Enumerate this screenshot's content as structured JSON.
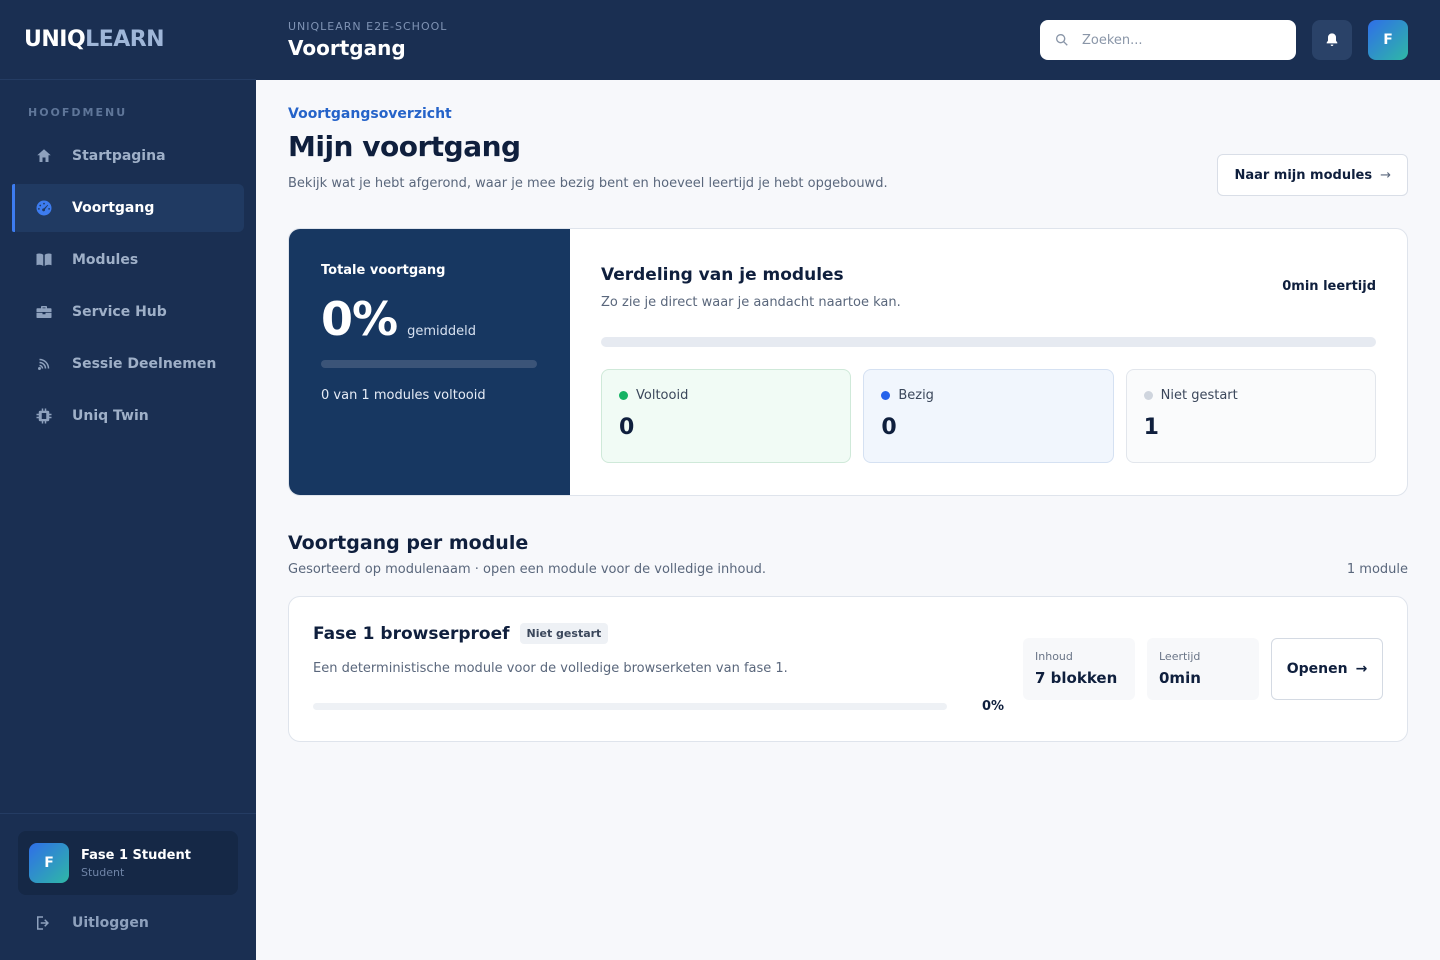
{
  "brand": {
    "logo_a": "UNIQ",
    "logo_b": "LEARN"
  },
  "sidebar": {
    "menu_label": "HOOFDMENU",
    "items": [
      {
        "label": "Startpagina",
        "icon": "home-icon"
      },
      {
        "label": "Voortgang",
        "icon": "gauge-icon",
        "active": true
      },
      {
        "label": "Modules",
        "icon": "book-icon"
      },
      {
        "label": "Service Hub",
        "icon": "toolbox-icon"
      },
      {
        "label": "Sessie Deelnemen",
        "icon": "broadcast-icon"
      },
      {
        "label": "Uniq Twin",
        "icon": "chip-icon"
      }
    ],
    "user": {
      "initial": "F",
      "name": "Fase 1 Student",
      "role": "Student"
    },
    "logout_label": "Uitloggen"
  },
  "topbar": {
    "school": "UNIQLEARN E2E-SCHOOL",
    "title": "Voortgang",
    "search_placeholder": "Zoeken...",
    "avatar_initial": "F"
  },
  "page": {
    "breadcrumb": "Voortgangsoverzicht",
    "title": "Mijn voortgang",
    "subtitle": "Bekijk wat je hebt afgerond, waar je mee bezig bent en hoeveel leertijd je hebt opgebouwd.",
    "modules_button": "Naar mijn modules",
    "modules_button_arrow": "→"
  },
  "summary": {
    "total_label": "Totale voortgang",
    "total_percent": "0%",
    "total_progress": 0,
    "average_label": "gemiddeld",
    "completed_text": "0 van 1 modules voltooid",
    "dist_title": "Verdeling van je modules",
    "dist_subtitle": "Zo zie je direct waar je aandacht naartoe kan.",
    "learning_time": "0min leertijd",
    "stats": [
      {
        "label": "Voltooid",
        "value": "0",
        "color": "#16b364"
      },
      {
        "label": "Bezig",
        "value": "0",
        "color": "#2563eb"
      },
      {
        "label": "Niet gestart",
        "value": "1",
        "color": "#cfd5de"
      }
    ]
  },
  "modules_section": {
    "title": "Voortgang per module",
    "subtitle": "Gesorteerd op modulenaam · open een module voor de volledige inhoud.",
    "count": "1 module",
    "modules": [
      {
        "title": "Fase 1 browserproef",
        "status": "Niet gestart",
        "description": "Een deterministische module voor de volledige browserketen van fase 1.",
        "progress_label": "0%",
        "progress": 0,
        "content_label": "Inhoud",
        "content_value": "7 blokken",
        "time_label": "Leertijd",
        "time_value": "0min",
        "open_label": "Openen",
        "open_arrow": "→"
      }
    ]
  }
}
